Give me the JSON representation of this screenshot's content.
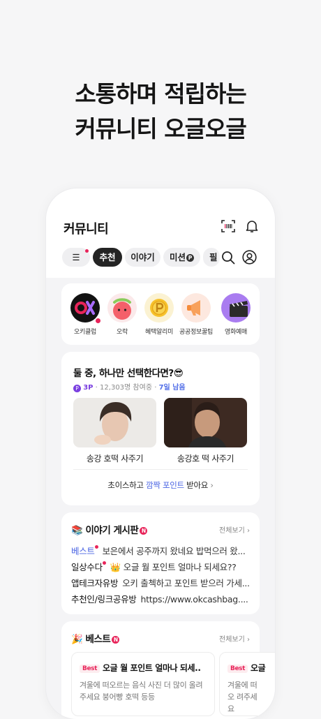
{
  "headline": {
    "line1": "소통하며 적립하는",
    "line2": "커뮤니티 오글오글"
  },
  "app_bar": {
    "title": "커뮤니티"
  },
  "tabs": [
    {
      "label": "☰",
      "dot": true
    },
    {
      "label": "추천",
      "active": true
    },
    {
      "label": "이야기"
    },
    {
      "label": "미션",
      "badge": "P"
    },
    {
      "label": "필"
    }
  ],
  "services": [
    {
      "label": "오키클럽",
      "icon": "okclub-icon",
      "color": "#121212",
      "dot": true
    },
    {
      "label": "오락",
      "icon": "peach-character-icon",
      "color": "#fbe9ea"
    },
    {
      "label": "혜택알리미",
      "icon": "coin-icon",
      "color": "#fbf2d2"
    },
    {
      "label": "공공정보꿀팁",
      "icon": "megaphone-icon",
      "color": "#fde8df"
    },
    {
      "label": "영화예매",
      "icon": "clapperboard-icon",
      "color": "#ece2fb"
    }
  ],
  "poll": {
    "title": "둘 중, 하나만 선택한다면?😎",
    "points": "3P",
    "participants": "12,303명 참여중",
    "days_left": "7일 남음",
    "options": [
      {
        "label": "송강 호떡 사주기"
      },
      {
        "label": "송강호 떡 사주기"
      }
    ],
    "cta_prefix": "초이스하고 ",
    "cta_highlight": "깜짝 포인트",
    "cta_suffix": " 받아요",
    "cta_arrow": "›",
    "middle_dot": "·"
  },
  "story_board": {
    "emoji": "📚",
    "title": "이야기 게시판",
    "badge": "N",
    "see_all": "전체보기 ›",
    "rows": [
      {
        "category": "베스트",
        "dot": true,
        "text": "보은에서 공주까지 왔네요 밥먹으러 왔..."
      },
      {
        "category": "일상수다",
        "dot": true,
        "text": "👑 오글 월 포인트 얼마나 되세요??"
      },
      {
        "category": "앱테크자유방",
        "dot": false,
        "text": "오키 출첵하고 포인트 받으러 가세..."
      },
      {
        "category": "추천인/링크공유방",
        "dot": false,
        "text": "https://www.okcashbag...."
      }
    ]
  },
  "best": {
    "emoji": "🎉",
    "title": "베스트",
    "badge": "N",
    "see_all": "전체보기 ›",
    "cards": [
      {
        "tag": "Best",
        "title": "오글 월 포인트 얼마나 되세..",
        "body": "겨울에 떠오르는 음식 사진 더 많이 올려주세요 붕어빵 호떡 등등"
      },
      {
        "tag": "Best",
        "title": "오글",
        "body": "겨울에 떠오 려주세요"
      }
    ]
  }
}
